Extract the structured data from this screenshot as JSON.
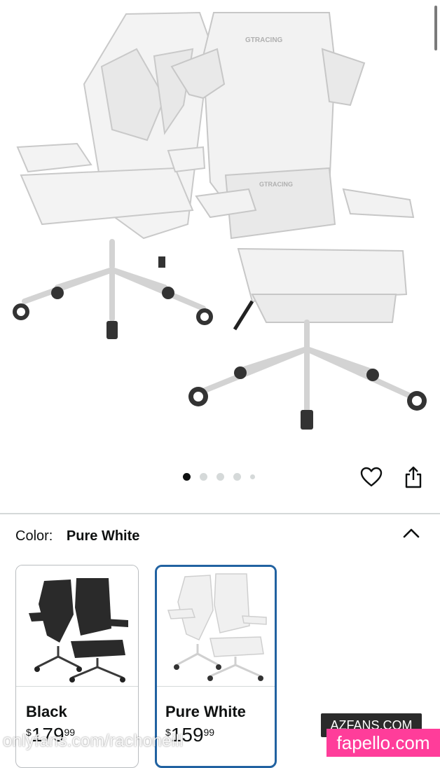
{
  "hero": {
    "image_alt_brand": "GTRACING",
    "carousel": {
      "total": 5,
      "active": 0
    }
  },
  "actions": {
    "favorite_icon": "heart-icon",
    "share_icon": "share-icon"
  },
  "color_selector": {
    "label": "Color:",
    "selected": "Pure White",
    "collapse_icon": "chevron-up-icon",
    "options": [
      {
        "name": "Black",
        "currency": "$",
        "price_whole": "179",
        "price_fraction": "99",
        "selected": false
      },
      {
        "name": "Pure White",
        "currency": "$",
        "price_whole": "159",
        "price_fraction": "99",
        "selected": true
      }
    ]
  },
  "colors": {
    "selected_border": "#2162a1",
    "unselected_border": "#b9bcbf",
    "dot_active": "#0f1111",
    "dot_inactive": "#d5d9d9"
  },
  "watermarks": {
    "left": "onlyfans.com/rachoneill",
    "badge": "AZFANS.COM",
    "pink": "fapello.com"
  }
}
